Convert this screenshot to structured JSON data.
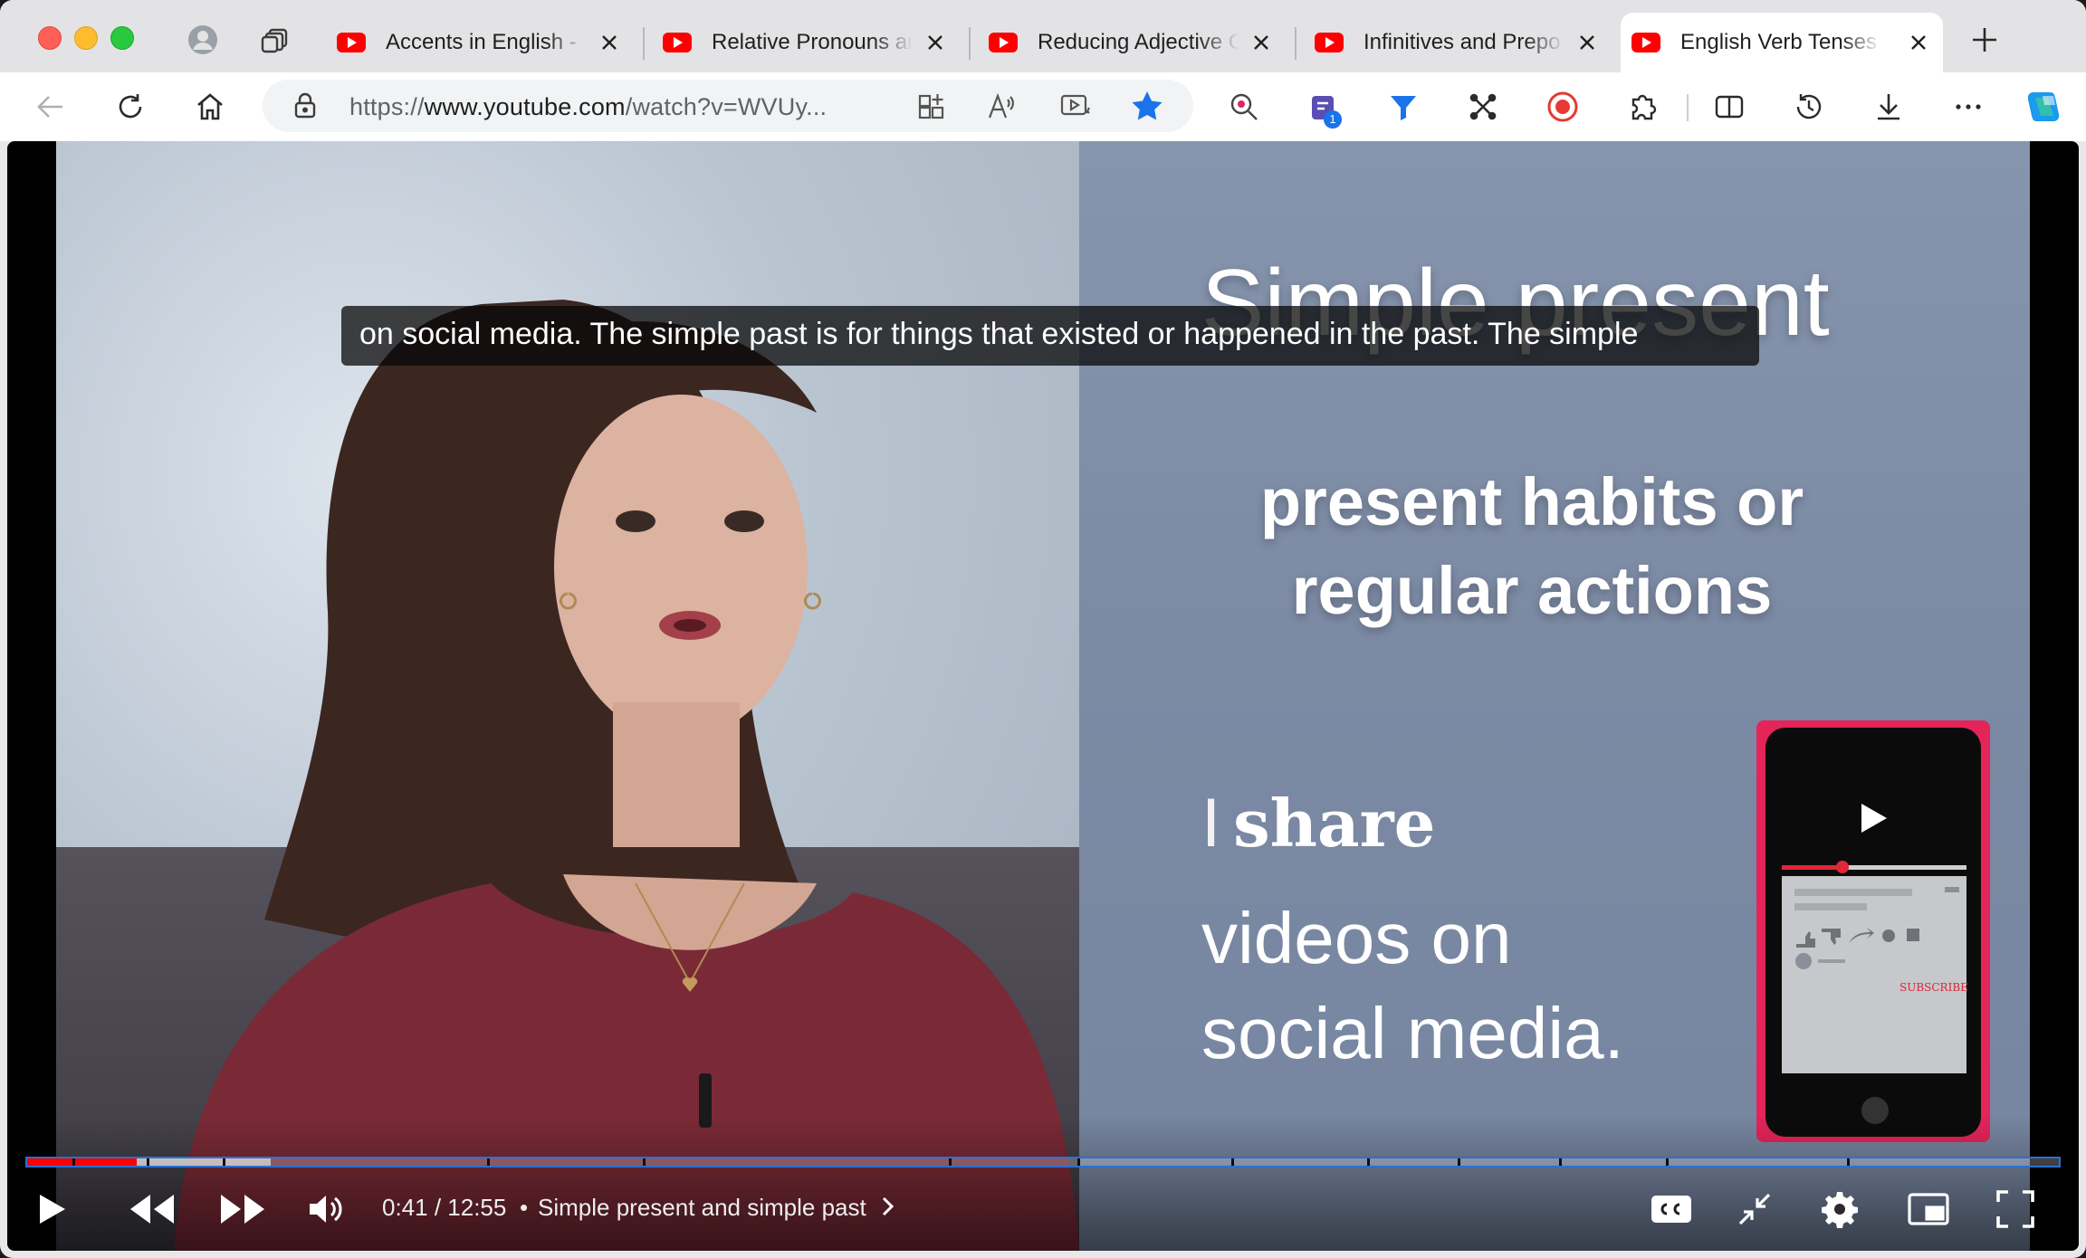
{
  "browser": {
    "tabs": [
      {
        "title": "Accents in English -",
        "active": false
      },
      {
        "title": "Relative Pronouns and",
        "active": false
      },
      {
        "title": "Reducing Adjective C",
        "active": false
      },
      {
        "title": "Infinitives and Prepo",
        "active": false
      },
      {
        "title": "English Verb Tenses",
        "active": true
      }
    ],
    "address": {
      "scheme": "https://",
      "host": "www.youtube.com",
      "path": "/watch?v=WVUy..."
    },
    "extension_badge": "1",
    "accent_color": "#1a73e8"
  },
  "video": {
    "caption": "on social media. The simple past is for things  that existed or happened in the past. The simple",
    "slide": {
      "title": "Simple present",
      "subtitle_line1": "present habits or",
      "subtitle_line2": "regular actions",
      "example_pronoun": "I",
      "example_verb": "share",
      "example_line2": "videos on",
      "example_line3": "social media."
    },
    "phone_subscribe": "SUBSCRIBE",
    "time_current": "0:41",
    "time_total": "12:55",
    "time_display": "0:41 / 12:55",
    "chapter_separator": "•",
    "chapter": "Simple present and simple past",
    "played_fraction": 0.054,
    "buffered_fraction": 0.12,
    "progress_color": "#ff0000"
  }
}
